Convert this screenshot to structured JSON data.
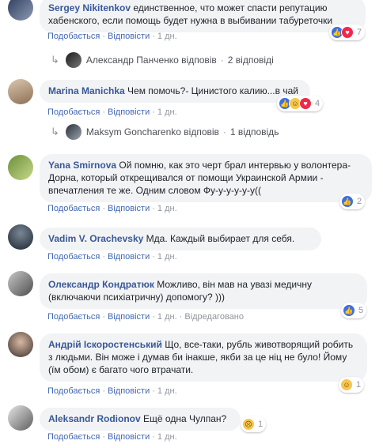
{
  "comments": [
    {
      "author": "Sergey Nikitenkov",
      "text": "единственное, что может спасти репутацию хабенского, если помощь будет нужна в выбивании табуреточки",
      "actions": [
        "Подобається",
        "Відповісти",
        "1 дн."
      ],
      "reactions": [
        "like-icon",
        "love-icon"
      ],
      "reaction_count": "7",
      "replies": {
        "name": "Александр Панченко відповів",
        "count": "2 відповіді"
      }
    },
    {
      "author": "Marina Manichka",
      "text": "Чем помочь?- Цинистого калию...в чай",
      "actions": [
        "Подобається",
        "Відповісти",
        "1 дн."
      ],
      "reactions": [
        "like-icon",
        "haha-icon",
        "love-icon"
      ],
      "reaction_count": "4",
      "replies": {
        "name": "Maksym Goncharenko відповів",
        "count": "1 відповідь"
      }
    },
    {
      "author": "Yana Smirnova",
      "text": "Ой помню, как это черт брал интервью у волонтера-Дорна, который открещивался от помощи Украинской Армии - впечатления те же. Одним словом Фу-у-у-у-у-у((",
      "actions": [
        "Подобається",
        "Відповісти",
        "1 дн."
      ],
      "reactions": [
        "like-icon"
      ],
      "reaction_count": "2"
    },
    {
      "author": "Vadim V. Orachevsky",
      "text": "Мда. Каждый выбирает для себя.",
      "actions": [
        "Подобається",
        "Відповісти",
        "1 дн."
      ]
    },
    {
      "author": "Олександр Кондратюк",
      "text": "Можливо, він мав на увазі медичну (включаючи психіатричну) допомогу? )))",
      "actions": [
        "Подобається",
        "Відповісти",
        "1 дн.",
        "Відредаговано"
      ],
      "reactions": [
        "like-icon"
      ],
      "reaction_count": "5"
    },
    {
      "author": "Андрій Іскоростенський",
      "text": "Що, все-таки, рубль животворящий робить з людьми. Він може і думав би інакше, якби за це ніц не було! Йому (їм обом) є багато чого втрачати.",
      "actions": [
        "Подобається",
        "Відповісти",
        "1 дн."
      ],
      "reactions": [
        "haha-icon"
      ],
      "reaction_count": "1"
    },
    {
      "author": "Aleksandr Rodionov",
      "text": "Ещё одна Чулпан?",
      "actions": [
        "Подобається",
        "Відповісти",
        "1 дн."
      ],
      "reactions": [
        "sad-icon"
      ],
      "reaction_count": "1"
    }
  ]
}
